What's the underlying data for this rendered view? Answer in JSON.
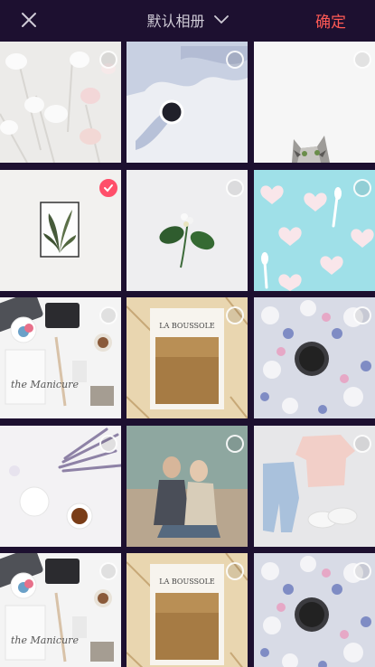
{
  "header": {
    "album_title": "默认相册",
    "confirm_label": "确定"
  },
  "colors": {
    "topbar_bg": "#1d1030",
    "accent": "#ff5a55",
    "selected_check": "#ff4f6a"
  },
  "photos": [
    {
      "subject": "macarons",
      "selected": false
    },
    {
      "subject": "cup-shadow",
      "selected": false
    },
    {
      "subject": "cat",
      "selected": false
    },
    {
      "subject": "plant-frame",
      "selected": true
    },
    {
      "subject": "flower-sprig",
      "selected": false
    },
    {
      "subject": "meringue-hearts",
      "selected": false
    },
    {
      "subject": "desk-flatlay",
      "selected": false
    },
    {
      "subject": "la-boussole-book",
      "selected": false
    },
    {
      "subject": "floral-coffee",
      "selected": false
    },
    {
      "subject": "lavender-tea",
      "selected": false
    },
    {
      "subject": "couple",
      "selected": false
    },
    {
      "subject": "clothes-flatlay",
      "selected": false
    },
    {
      "subject": "desk-flatlay",
      "selected": false
    },
    {
      "subject": "la-boussole-book",
      "selected": false
    },
    {
      "subject": "floral-coffee",
      "selected": false
    }
  ],
  "book_text": {
    "title": "LA BOUSSOLE"
  },
  "desk_text": {
    "notebook": "the Manicure"
  }
}
